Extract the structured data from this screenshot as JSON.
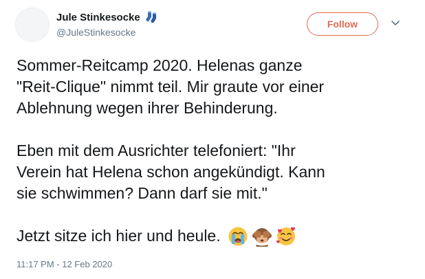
{
  "author": {
    "display_name": "Jule Stinkesocke",
    "handle": "@JuleStinkesocke",
    "name_emoji": "socks-icon"
  },
  "follow_button": {
    "label": "Follow"
  },
  "tweet": {
    "paragraphs": [
      [
        "Sommer-Reitcamp 2020. Helenas ganze",
        "\"Reit-Clique\" nimmt teil. Mir graute vor einer",
        "Ablehnung wegen ihrer Behinderung."
      ],
      [
        "Eben mit dem Ausrichter telefoniert: \"Ihr",
        "Verein hat Helena schon angekündigt. Kann",
        "sie schwimmen? Dann darf sie mit.\""
      ]
    ],
    "last_line": "Jetzt sitze ich hier und heule.",
    "emojis": [
      "crying-face-icon",
      "see-no-evil-monkey-icon",
      "smiling-face-with-hearts-icon"
    ]
  },
  "timestamp": "11:17 PM - 12 Feb 2020",
  "colors": {
    "accent": "#e0694f",
    "text": "#14171a",
    "secondary": "#657786"
  }
}
